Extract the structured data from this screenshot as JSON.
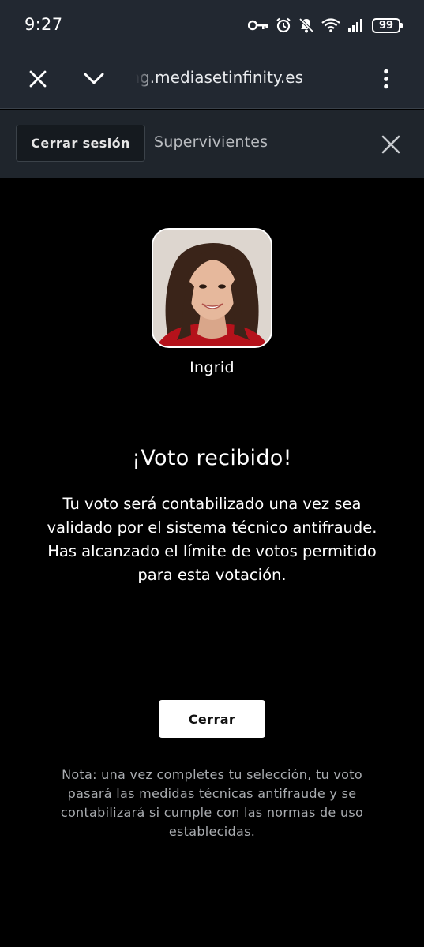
{
  "status_bar": {
    "time": "9:27",
    "battery": "99",
    "icons": [
      "vpn-key-icon",
      "alarm-icon",
      "notifications-off-icon",
      "wifi-icon",
      "signal-icon",
      "battery-icon"
    ]
  },
  "browser": {
    "url": "voting.mediasetinfinity.es",
    "close_icon": "close-icon",
    "collapse_icon": "chevron-down-icon",
    "menu_icon": "more-vert-icon"
  },
  "header": {
    "logout_label": "Cerrar sesión",
    "title": "Supervivientes",
    "close_icon": "close-icon"
  },
  "candidate": {
    "name": "Ingrid"
  },
  "result": {
    "title": "¡Voto recibido!",
    "message": "Tu voto será contabilizado una vez sea validado por el sistema técnico antifraude. Has alcanzado el límite de votos permitido para esta votación."
  },
  "actions": {
    "close_label": "Cerrar"
  },
  "footnote": "Nota: una vez completes tu selección, tu voto pasará las medidas técnicas antifraude y se contabilizará si cumple con las normas de uso establecidas.",
  "colors": {
    "background": "#000000",
    "browser_bar": "#222831",
    "header_bar": "#1f252c",
    "button_primary": "#ffffff",
    "footnote_text": "#a9acb0"
  }
}
